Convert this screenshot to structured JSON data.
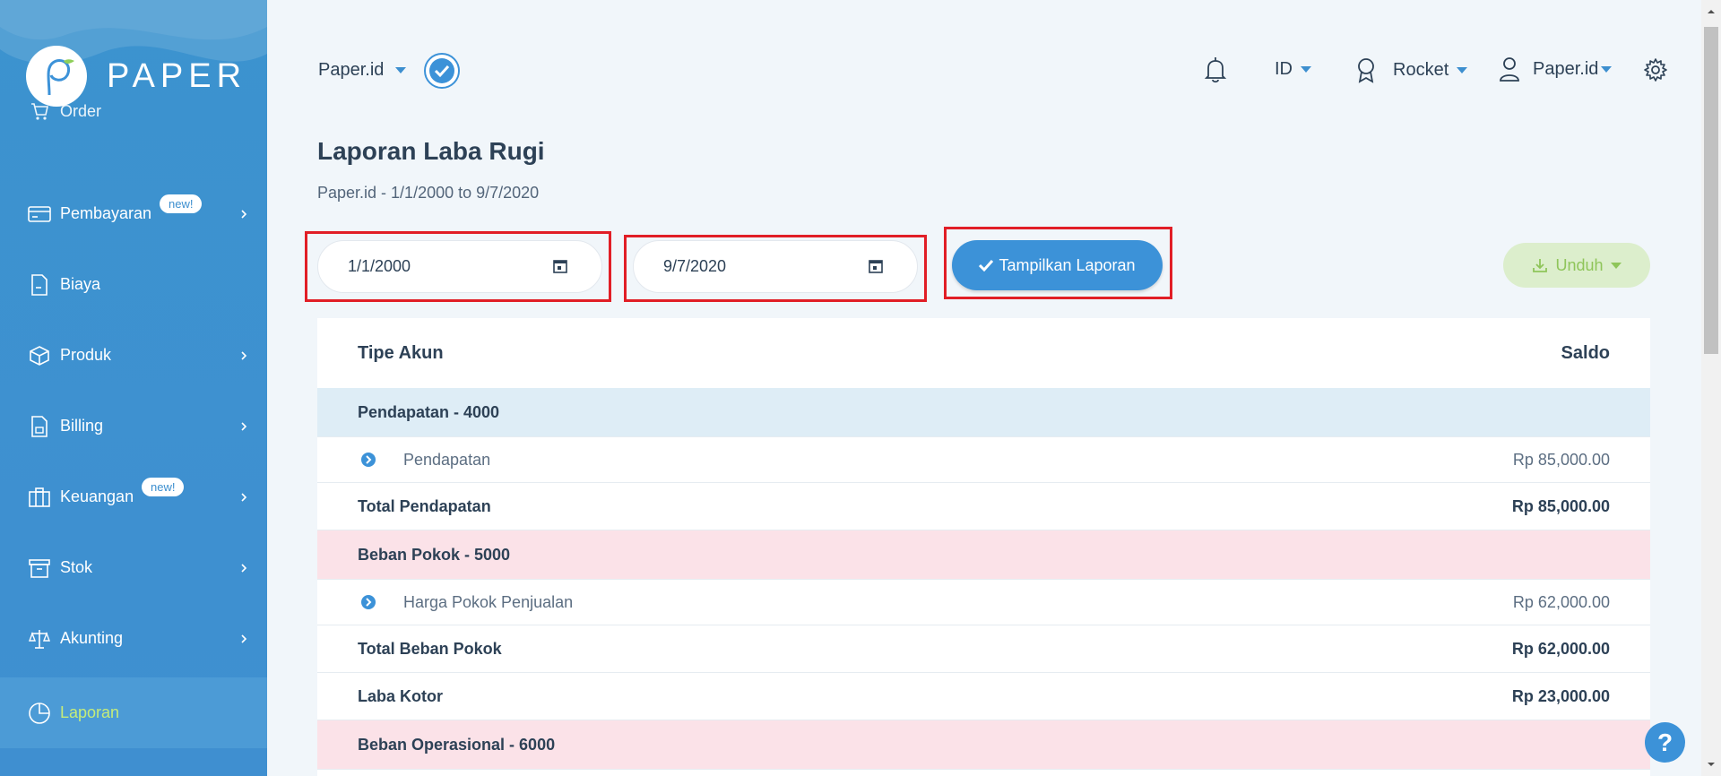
{
  "brand": {
    "name": "PAPER"
  },
  "sidebar": {
    "items": [
      {
        "label": "Order"
      },
      {
        "label": "Pembayaran",
        "badge": "new!"
      },
      {
        "label": "Biaya"
      },
      {
        "label": "Produk"
      },
      {
        "label": "Billing"
      },
      {
        "label": "Keuangan",
        "badge": "new!"
      },
      {
        "label": "Stok"
      },
      {
        "label": "Akunting"
      },
      {
        "label": "Laporan"
      }
    ]
  },
  "header": {
    "company": "Paper.id",
    "language": "ID",
    "plan": "Rocket",
    "user": "Paper.id"
  },
  "report": {
    "title": "Laporan Laba Rugi",
    "subtitle": "Paper.id - 1/1/2000 to 9/7/2020",
    "start_date": "1/1/2000",
    "end_date": "9/7/2020",
    "show_button": "Tampilkan Laporan",
    "download_button": "Unduh"
  },
  "table": {
    "col_account": "Tipe Akun",
    "col_balance": "Saldo",
    "rows": [
      {
        "label": "Pendapatan - 4000",
        "value": ""
      },
      {
        "label": "Pendapatan",
        "value": "Rp 85,000.00"
      },
      {
        "label": "Total Pendapatan",
        "value": "Rp 85,000.00"
      },
      {
        "label": "Beban Pokok - 5000",
        "value": ""
      },
      {
        "label": "Harga Pokok Penjualan",
        "value": "Rp 62,000.00"
      },
      {
        "label": "Total Beban Pokok",
        "value": "Rp 62,000.00"
      },
      {
        "label": "Laba Kotor",
        "value": "Rp 23,000.00"
      },
      {
        "label": "Beban Operasional - 6000",
        "value": ""
      }
    ]
  },
  "help": {
    "label": "?"
  }
}
